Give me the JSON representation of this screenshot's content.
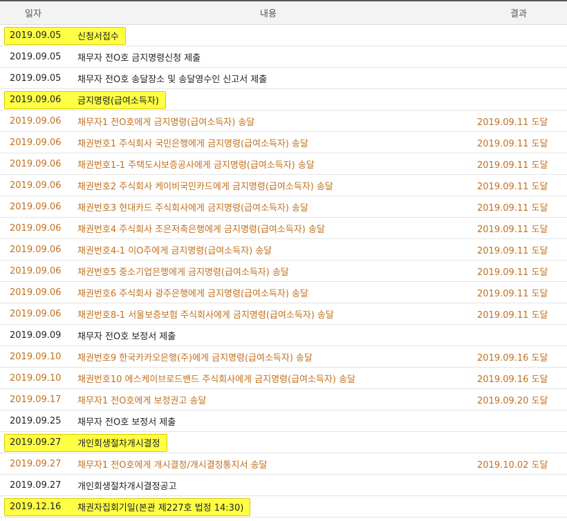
{
  "header": {
    "date": "일자",
    "content": "내용",
    "result": "결과"
  },
  "rows": [
    {
      "date": "2019.09.05",
      "content": "신청서접수",
      "result": "",
      "style": "highlight"
    },
    {
      "date": "2019.09.05",
      "content": "채무자 전O호 금지명령신청 제출",
      "result": "",
      "style": "normal"
    },
    {
      "date": "2019.09.05",
      "content": "채무자 전O호 송달장소 및 송달영수인 신고서 제출",
      "result": "",
      "style": "normal"
    },
    {
      "date": "2019.09.06",
      "content": "금지명령(급여소득자)",
      "result": "",
      "style": "highlight"
    },
    {
      "date": "2019.09.06",
      "content": "채무자1 전O호에게 금지명령(급여소득자) 송달",
      "result": "2019.09.11 도달",
      "style": "orange"
    },
    {
      "date": "2019.09.06",
      "content": "채권번호1 주식회사 국민은행에게 금지명령(급여소득자) 송달",
      "result": "2019.09.11 도달",
      "style": "orange"
    },
    {
      "date": "2019.09.06",
      "content": "채권번호1-1 주택도시보증공사에게 금지명령(급여소득자) 송달",
      "result": "2019.09.11 도달",
      "style": "orange"
    },
    {
      "date": "2019.09.06",
      "content": "채권번호2 주식회사 케이비국민카드에게 금지명령(급여소득자) 송달",
      "result": "2019.09.11 도달",
      "style": "orange"
    },
    {
      "date": "2019.09.06",
      "content": "채권번호3 현대카드 주식회사에게 금지명령(급여소득자) 송달",
      "result": "2019.09.11 도달",
      "style": "orange"
    },
    {
      "date": "2019.09.06",
      "content": "채권번호4 주식회사 조은저축은행에게 금지명령(급여소득자) 송달",
      "result": "2019.09.11 도달",
      "style": "orange"
    },
    {
      "date": "2019.09.06",
      "content": "채권번호4-1 이O주에게 금지명령(급여소득자) 송달",
      "result": "2019.09.11 도달",
      "style": "orange"
    },
    {
      "date": "2019.09.06",
      "content": "채권번호5 중소기업은행에게 금지명령(급여소득자) 송달",
      "result": "2019.09.11 도달",
      "style": "orange"
    },
    {
      "date": "2019.09.06",
      "content": "채권번호6 주식회사 광주은행에게 금지명령(급여소득자) 송달",
      "result": "2019.09.11 도달",
      "style": "orange"
    },
    {
      "date": "2019.09.06",
      "content": "채권번호8-1 서울보증보험 주식회사에게 금지명령(급여소득자) 송달",
      "result": "2019.09.11 도달",
      "style": "orange"
    },
    {
      "date": "2019.09.09",
      "content": "채무자 전O호 보정서 제출",
      "result": "",
      "style": "normal"
    },
    {
      "date": "2019.09.10",
      "content": "채권번호9 한국카카오은행(주)에게 금지명령(급여소득자) 송달",
      "result": "2019.09.16 도달",
      "style": "orange"
    },
    {
      "date": "2019.09.10",
      "content": "채권번호10 에스케이브로드밴드 주식회사에게 금지명령(급여소득자) 송달",
      "result": "2019.09.16 도달",
      "style": "orange"
    },
    {
      "date": "2019.09.17",
      "content": "채무자1 전O호에게 보정권고 송달",
      "result": "2019.09.20 도달",
      "style": "orange"
    },
    {
      "date": "2019.09.25",
      "content": "채무자 전O호 보정서 제출",
      "result": "",
      "style": "normal"
    },
    {
      "date": "2019.09.27",
      "content": "개인회생절차개시결정",
      "result": "",
      "style": "highlight"
    },
    {
      "date": "2019.09.27",
      "content": "채무자1 전O호에게 개시결정/개시결정통지서 송달",
      "result": "2019.10.02 도달",
      "style": "orange"
    },
    {
      "date": "2019.09.27",
      "content": "개인회생절차개시결정공고",
      "result": "",
      "style": "normal"
    },
    {
      "date": "2019.12.16",
      "content": "채권자집회기일(본관 제227호 법정 14:30)",
      "result": "",
      "style": "highlight"
    }
  ],
  "colors": {
    "highlight_fill": "#ffff44",
    "orange_text": "#c0701e",
    "header_bg": "#f3f3f3"
  }
}
